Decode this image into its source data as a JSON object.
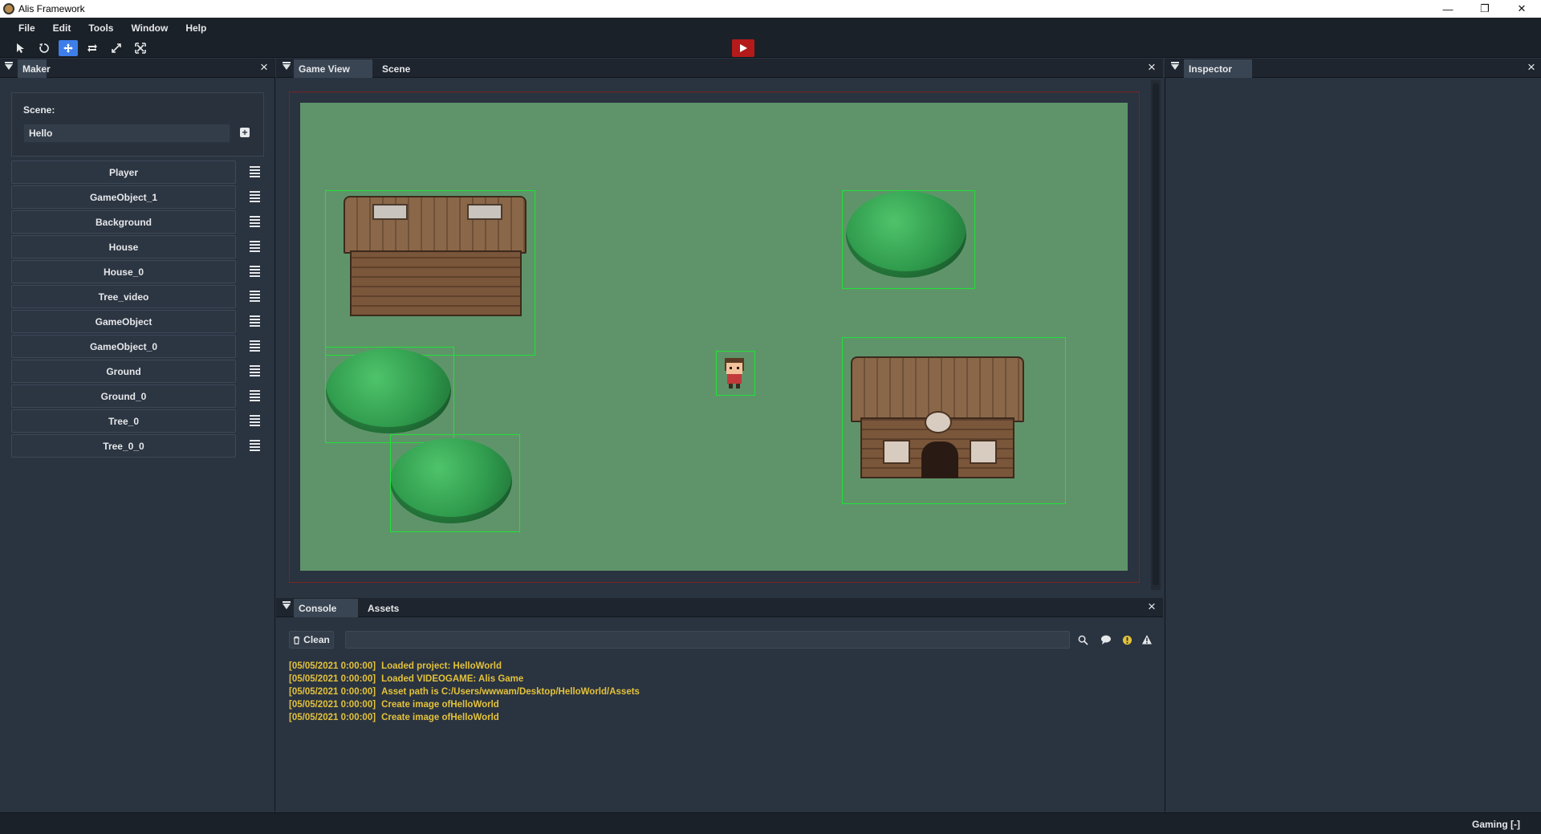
{
  "window": {
    "title": "Alis Framework",
    "minimize": "—",
    "restore": "❐",
    "close": "✕"
  },
  "menu": [
    "File",
    "Edit",
    "Tools",
    "Window",
    "Help"
  ],
  "toolbar": {
    "tools": [
      "select-tool",
      "rotate-tool",
      "move-tool",
      "loop-tool",
      "scale-tool",
      "fullscreen-tool"
    ],
    "active_tool": "move-tool",
    "play_color": "#b41a1a"
  },
  "maker": {
    "tab": "Maker",
    "scene_label": "Scene:",
    "scene_value": "Hello",
    "objects": [
      "Player",
      "GameObject_1",
      "Background",
      "House",
      "House_0",
      "Tree_video",
      "GameObject",
      "GameObject_0",
      "Ground",
      "Ground_0",
      "Tree_0",
      "Tree_0_0"
    ]
  },
  "gameview": {
    "tabs": [
      "Game View",
      "Scene"
    ],
    "active_tab": "Game View",
    "selection_color": "#22e03a",
    "canvas_color": "#5f946a"
  },
  "inspector": {
    "tab": "Inspector"
  },
  "console": {
    "tabs": [
      "Console",
      "Assets"
    ],
    "active_tab": "Console",
    "clean_label": "Clean",
    "search_value": "",
    "log_color": "#e3c23b",
    "logs": [
      {
        "time": "[05/05/2021 0:00:00]",
        "message": "Loaded project: HelloWorld"
      },
      {
        "time": "[05/05/2021 0:00:00]",
        "message": "Loaded VIDEOGAME: Alis Game"
      },
      {
        "time": "[05/05/2021 0:00:00]",
        "message": "Asset path is C:/Users/wwwam/Desktop/HelloWorld/Assets"
      },
      {
        "time": "[05/05/2021 0:00:00]",
        "message": "Create image ofHelloWorld"
      },
      {
        "time": "[05/05/2021 0:00:00]",
        "message": "Create image ofHelloWorld"
      }
    ]
  },
  "status": {
    "text": "Gaming [-]"
  }
}
